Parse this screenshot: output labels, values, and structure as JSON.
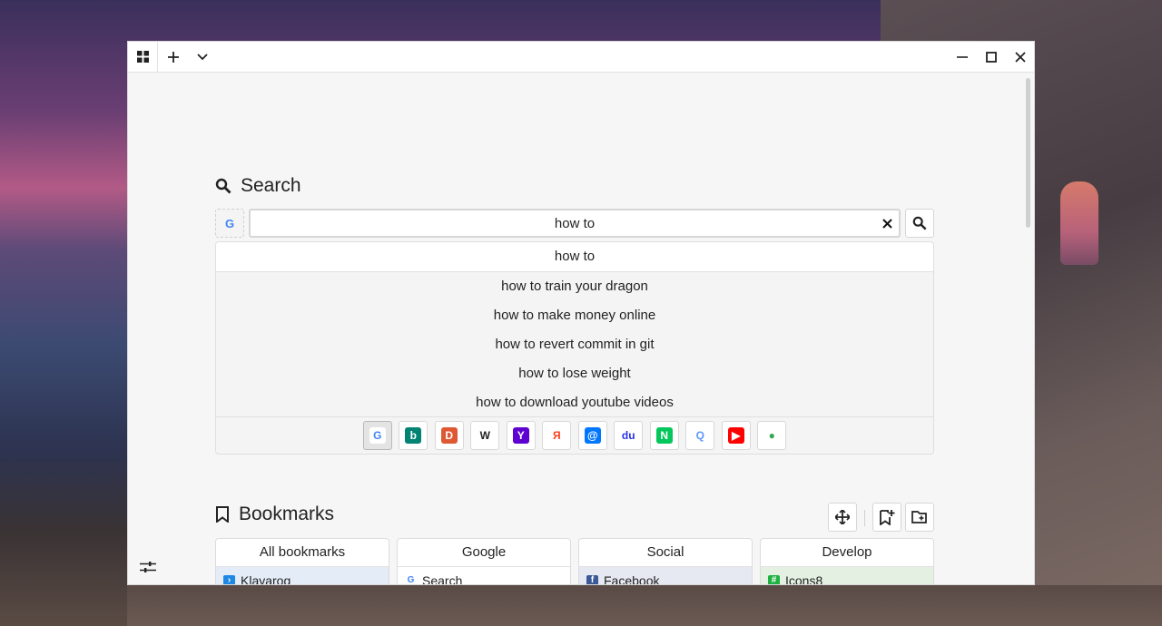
{
  "titlebar": {
    "apps_icon": "grid-icon",
    "new_tab_icon": "plus-icon",
    "menu_icon": "chevron-down-icon",
    "minimize_icon": "minimize-icon",
    "maximize_icon": "maximize-icon",
    "close_icon": "close-icon"
  },
  "search": {
    "title": "Search",
    "query": "how to",
    "current_engine": "Google",
    "suggestions": [
      "how to",
      "how to train your dragon",
      "how to make money online",
      "how to revert commit in git",
      "how to lose weight",
      "how to download youtube videos"
    ],
    "engines": [
      {
        "name": "Google",
        "glyph": "G",
        "color": "#4285f4",
        "bg": "#ffffff"
      },
      {
        "name": "Bing",
        "glyph": "b",
        "color": "#ffffff",
        "bg": "#008373"
      },
      {
        "name": "DuckDuckGo",
        "glyph": "D",
        "color": "#ffffff",
        "bg": "#de5833"
      },
      {
        "name": "Wikipedia",
        "glyph": "W",
        "color": "#222222",
        "bg": "#ffffff"
      },
      {
        "name": "Yahoo",
        "glyph": "Y",
        "color": "#ffffff",
        "bg": "#5f01d1"
      },
      {
        "name": "Yandex",
        "glyph": "Я",
        "color": "#fc3f1d",
        "bg": "#ffffff"
      },
      {
        "name": "Mail.ru",
        "glyph": "@",
        "color": "#ffffff",
        "bg": "#0077ff"
      },
      {
        "name": "Baidu",
        "glyph": "du",
        "color": "#2932e1",
        "bg": "#ffffff"
      },
      {
        "name": "Naver",
        "glyph": "N",
        "color": "#ffffff",
        "bg": "#03c75a"
      },
      {
        "name": "Qwant",
        "glyph": "Q",
        "color": "#5c97ff",
        "bg": "#ffffff"
      },
      {
        "name": "YouTube",
        "glyph": "▶",
        "color": "#ffffff",
        "bg": "#ff0000"
      },
      {
        "name": "Chrome Web Store",
        "glyph": "●",
        "color": "#34a853",
        "bg": "#ffffff"
      }
    ]
  },
  "bookmarks": {
    "title": "Bookmarks",
    "columns": [
      {
        "title": "All bookmarks",
        "item": "Klavarog",
        "fav_bg": "#1e88e5",
        "fav_glyph": "›",
        "row_bg": "#e3ecf7"
      },
      {
        "title": "Google",
        "item": "Search",
        "fav_bg": "#ffffff",
        "fav_glyph": "G",
        "row_bg": "#ffffff"
      },
      {
        "title": "Social",
        "item": "Facebook",
        "fav_bg": "#3b5998",
        "fav_glyph": "f",
        "row_bg": "#e6e9f1"
      },
      {
        "title": "Develop",
        "item": "Icons8",
        "fav_bg": "#1fb141",
        "fav_glyph": "#",
        "row_bg": "#e4f1e2"
      }
    ]
  },
  "settings_icon": "sliders-icon"
}
